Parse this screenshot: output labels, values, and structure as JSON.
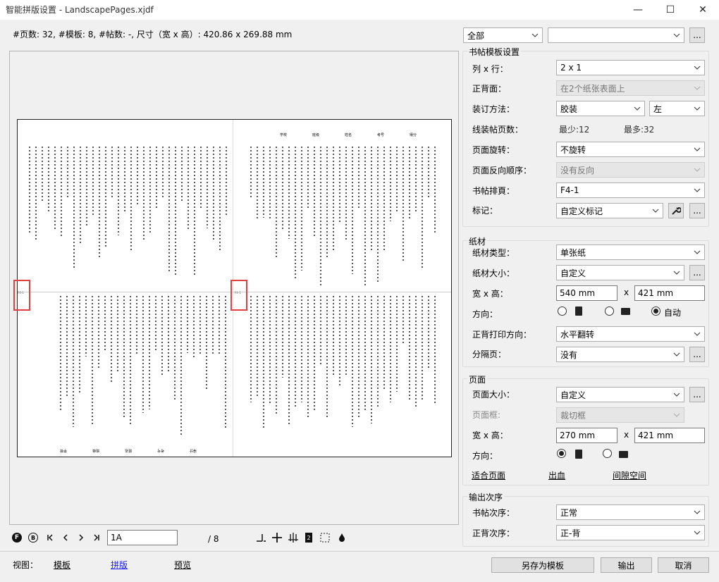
{
  "window": {
    "title": "智能拼版设置 - LandscapePages.xjdf",
    "minimize": "—",
    "maximize": "☐",
    "close": "✕"
  },
  "info": "#页数: 32, #模板: 8, #帖数: -, 尺寸（宽 x 高）: 420.86 x 269.88 mm",
  "filter": {
    "scope": "全部",
    "second": "",
    "more": "..."
  },
  "preview": {
    "marker": "F4-1",
    "top_labels": [
      "学校",
      "班级",
      "姓名",
      "考号",
      "得分"
    ],
    "bottom_labels": [
      "学校",
      "班级",
      "姓名",
      "考号",
      "得分"
    ]
  },
  "signature": {
    "section": "书帖模板设置",
    "cols_rows_label": "列 x 行：",
    "cols_rows": "2 x 1",
    "sides_label": "正背面：",
    "sides": "在2个纸张表面上",
    "binding_label": "装订方法：",
    "binding": "胶装",
    "binding_side": "左",
    "pages_label": "线装帖页数：",
    "min": "最少:12",
    "max": "最多:32",
    "rotation_label": "页面旋转：",
    "rotation": "不旋转",
    "reverse_label": "页面反向顺序：",
    "reverse": "没有反向",
    "impose_label": "书帖排頁：",
    "impose": "F4-1",
    "marks_label": "标记：",
    "marks": "自定义标记",
    "more": "..."
  },
  "paper": {
    "section": "纸材",
    "type_label": "纸材类型：",
    "type": "单张纸",
    "size_label": "纸材大小：",
    "size": "自定义",
    "wh_label": "宽 x 高：",
    "width": "540 mm",
    "x": "x",
    "height": "421 mm",
    "orient_label": "方向：",
    "auto": "自动",
    "flip_label": "正背打印方向：",
    "flip": "水平翻转",
    "sep_label": "分隔页：",
    "sep": "没有",
    "more": "..."
  },
  "page": {
    "section": "页面",
    "size_label": "页面大小：",
    "size": "自定义",
    "box_label": "页面框:",
    "box": "裁切框",
    "wh_label": "宽 x 高：",
    "width": "270 mm",
    "x": "x",
    "height": "421 mm",
    "orient_label": "方向：",
    "fit": "适合页面",
    "bleed": "出血",
    "gap": "间隙空间",
    "more": "..."
  },
  "output": {
    "section": "输出次序",
    "sig_order_label": "书帖次序：",
    "sig_order": "正常",
    "side_order_label": "正背次序：",
    "side_order": "正-背"
  },
  "nav": {
    "front": "F",
    "back": "B",
    "page": "1A",
    "total": "/ 8"
  },
  "view": {
    "label": "视图：",
    "tabs": [
      "模板",
      "拼版",
      "预览"
    ]
  },
  "actions": {
    "save_as": "另存为模板",
    "output": "输出",
    "cancel": "取消"
  }
}
